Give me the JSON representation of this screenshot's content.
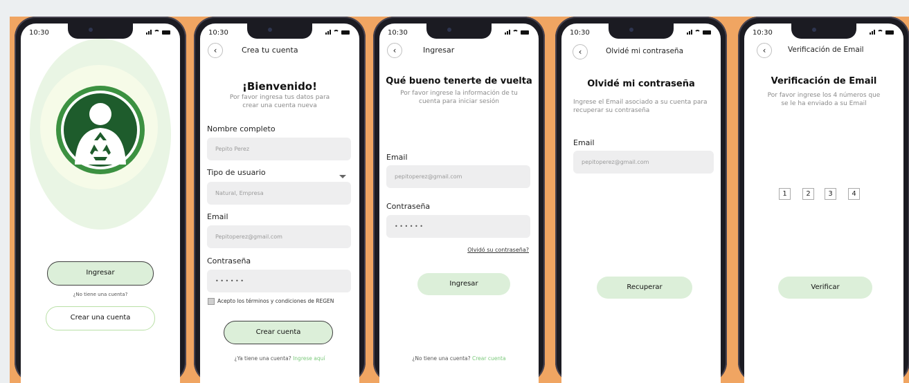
{
  "status_time": [
    "10:30",
    "10:30",
    "10:30",
    "10:30",
    "10:30"
  ],
  "colors": {
    "band": "#f0a562",
    "accent": "#dcefd9",
    "link_green": "#7bc97b",
    "logo_dark": "#1e5c2c"
  },
  "welcome": {
    "login_button": "Ingresar",
    "no_account": "¿No tiene una cuenta?",
    "create_button": "Crear una cuenta",
    "logo_icon": "recycle-person-icon"
  },
  "register": {
    "header": "Crea tu cuenta",
    "title": "¡Bienvenido!",
    "subtitle": "Por favor ingresa tus datos para crear una cuenta nueva",
    "name_label": "Nombre completo",
    "name_value": "Pepito Perez",
    "type_label": "Tipo de usuario",
    "type_value": "Natural, Empresa",
    "email_label": "Email",
    "email_value": "Pepitoperez@gmail.com",
    "password_label": "Contraseña",
    "password_value": "• • • • • •",
    "terms": "Acepto los términos y condiciones de REGEN",
    "create_button": "Crear cuenta",
    "have_account": "¿Ya tiene una cuenta?",
    "login_link": "Ingrese aquí"
  },
  "login": {
    "header": "Ingresar",
    "title": "Qué bueno tenerte de vuelta",
    "subtitle": "Por favor ingrese la información de tu cuenta para iniciar sesión",
    "email_label": "Email",
    "email_value": "pepitoperez@gmail.com",
    "password_label": "Contraseña",
    "password_value": "• • • • • •",
    "forgot_link": "Olvidó su contraseña?",
    "login_button": "Ingresar",
    "no_account": "¿No tiene una cuenta?",
    "create_link": "Crear cuenta"
  },
  "forgot": {
    "header": "Olvidé mi contraseña",
    "title": "Olvidé mi contraseña",
    "subtitle": "Ingrese el Email asociado a su cuenta para recuperar su contraseña",
    "email_label": "Email",
    "email_value": "pepitoperez@gmail.com",
    "recover_button": "Recuperar"
  },
  "verify": {
    "header": "Verificación de Email",
    "title": "Verificación de Email",
    "subtitle": "Por favor ingrese los 4 números que se le ha enviado a su Email",
    "code": [
      "1",
      "2",
      "3",
      "4"
    ],
    "verify_button": "Verificar"
  }
}
